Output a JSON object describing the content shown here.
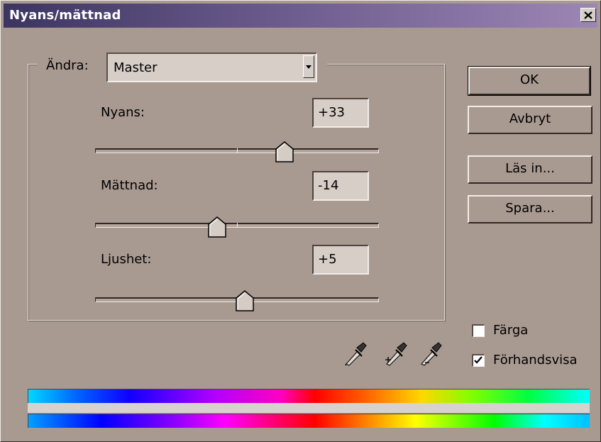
{
  "window": {
    "title": "Nyans/mättnad"
  },
  "edit": {
    "label": "Ändra:",
    "selected": "Master"
  },
  "hue": {
    "label": "Nyans:",
    "value": "+33",
    "range": [
      -180,
      180
    ]
  },
  "saturation": {
    "label": "Mättnad:",
    "value": "-14",
    "range": [
      -100,
      100
    ]
  },
  "lightness": {
    "label": "Ljushet:",
    "value": "+5",
    "range": [
      -100,
      100
    ]
  },
  "buttons": {
    "ok": "OK",
    "cancel": "Avbryt",
    "load": "Läs in...",
    "save": "Spara..."
  },
  "options": {
    "colorize": {
      "label": "Färga",
      "checked": false
    },
    "preview": {
      "label": "Förhandsvisa",
      "checked": true
    }
  },
  "icons": [
    "close-icon",
    "dropdown-arrow-icon",
    "eyedropper-icon",
    "eyedropper-plus-icon",
    "eyedropper-minus-icon",
    "checkmark-icon"
  ],
  "colors": {
    "title_start": "#3c3560",
    "title_end": "#9c86b4",
    "dialog_bg": "#a99a91"
  }
}
